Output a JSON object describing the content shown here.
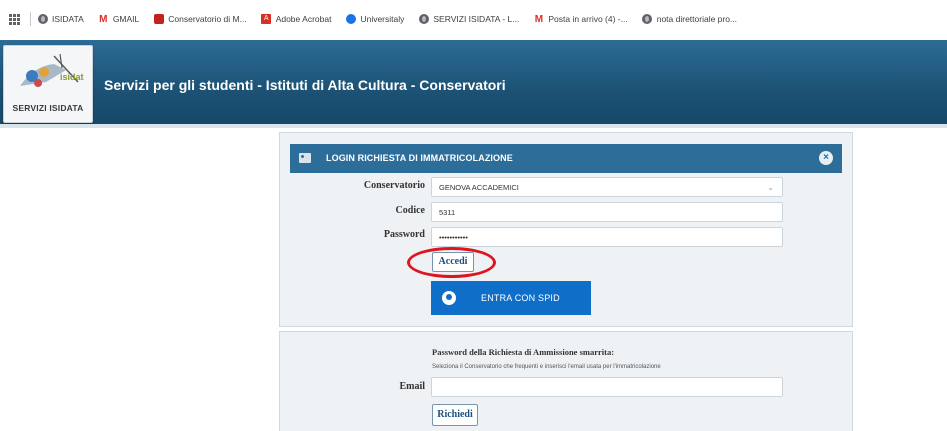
{
  "bookmarks": [
    {
      "label": "ISIDATA",
      "icon": "globe-icon"
    },
    {
      "label": "GMAIL",
      "icon": "gmail-icon"
    },
    {
      "label": "Conservatorio di M...",
      "icon": "red-square-icon"
    },
    {
      "label": "Adobe Acrobat",
      "icon": "pdf-icon"
    },
    {
      "label": "Universitaly",
      "icon": "universitaly-icon"
    },
    {
      "label": "SERVIZI ISIDATA - L...",
      "icon": "globe-icon"
    },
    {
      "label": "Posta in arrivo (4) -...",
      "icon": "gmail-icon"
    },
    {
      "label": "nota direttoriale pro...",
      "icon": "globe-icon"
    }
  ],
  "header": {
    "logo_caption": "SERVIZI ISIDATA",
    "logo_text": "isidata",
    "title": "Servizi per gli studenti - Istituti di Alta Cultura - Conservatori"
  },
  "login": {
    "title": "LOGIN RICHIESTA DI IMMATRICOLAZIONE",
    "conservatorio_label": "Conservatorio",
    "conservatorio_value": "GENOVA ACCADEMICI",
    "codice_label": "Codice",
    "codice_value": "5311",
    "password_label": "Password",
    "password_value": "•••••••••••",
    "accedi_label": "Accedi",
    "spid_label": "ENTRA CON SPID"
  },
  "recovery": {
    "title": "Password della Richiesta di Ammissione smarrita:",
    "text": "Seleziona il Conservatorio che frequenti e inserisci l'email usata per l'immatricolazione",
    "email_label": "Email",
    "email_value": "",
    "richiedi_label": "Richiedi"
  },
  "colors": {
    "header": "#1c5275",
    "panel_head": "#2d6d99",
    "spid": "#0f6fc8",
    "highlight": "#e0141f"
  }
}
